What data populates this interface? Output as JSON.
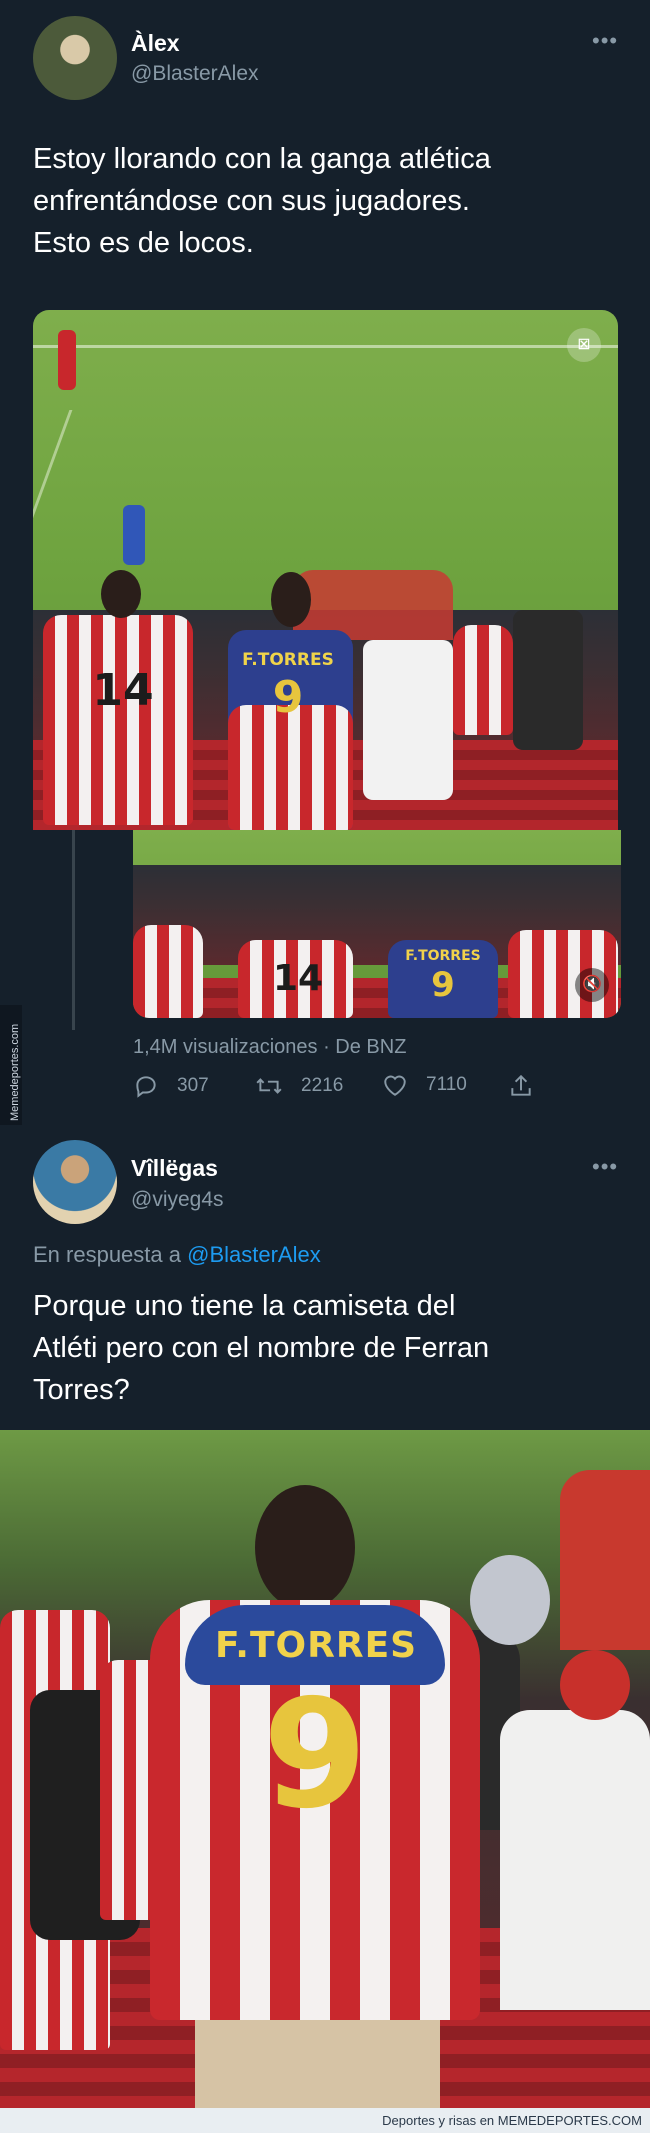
{
  "tweet1": {
    "name": "Àlex",
    "handle": "@BlasterAlex",
    "text_lines": [
      "Estoy llorando con la ganga atlética",
      "enfrentándose con sus jugadores.",
      "Esto es de locos."
    ],
    "video": {
      "jersey_14": "14",
      "jersey_name": "F.TORRES",
      "jersey_9": "9"
    },
    "views": "1,4M visualizaciones · De BNZ",
    "replies": "307",
    "retweets": "2216",
    "likes": "7110"
  },
  "tweet2": {
    "name": "Vîllëgas",
    "handle": "@viyeg4s",
    "reply_prefix": "En respuesta a",
    "reply_mention": "@BlasterAlex",
    "text_lines": [
      "Porque uno tiene la camiseta del",
      "Atléti pero con el nombre de Ferran",
      "Torres?"
    ],
    "photo": {
      "jersey_name": "F.TORRES",
      "jersey_9": "9"
    }
  },
  "more_icon": "more-dots-icon",
  "watermark_side": "Memedeportes.com",
  "footer": "Deportes y risas en MEMEDEPORTES.COM",
  "colors": {
    "background": "#15202b",
    "secondary_text": "#8899a6",
    "link": "#1d9bf0"
  }
}
